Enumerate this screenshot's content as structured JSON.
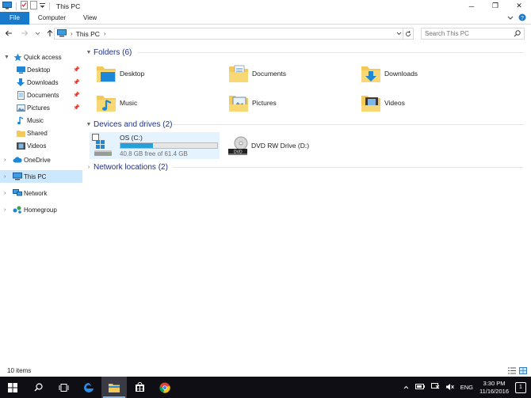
{
  "window": {
    "title": "This PC",
    "minimize": "─",
    "maximize": "❐",
    "close": "✕"
  },
  "ribbon": {
    "tabs": [
      "File",
      "Computer",
      "View"
    ]
  },
  "address": {
    "crumb": "This PC",
    "search_placeholder": "Search This PC"
  },
  "nav": {
    "quick_access": "Quick access",
    "quick_items": [
      "Desktop",
      "Downloads",
      "Documents",
      "Pictures",
      "Music",
      "Shared",
      "Videos"
    ],
    "onedrive": "OneDrive",
    "this_pc": "This PC",
    "network": "Network",
    "homegroup": "Homegroup"
  },
  "folders": {
    "header": "Folders (6)",
    "items": [
      "Desktop",
      "Documents",
      "Downloads",
      "Music",
      "Pictures",
      "Videos"
    ]
  },
  "devices": {
    "header": "Devices and drives (2)",
    "os_name": "OS (C:)",
    "os_free": "40.8 GB free of 61.4 GB",
    "os_used_fraction": 0.336,
    "dvd_name": "DVD RW Drive (D:)"
  },
  "network_locations": {
    "header": "Network locations (2)"
  },
  "status": {
    "items": "10 items"
  },
  "taskbar": {
    "lang": "ENG",
    "time": "3:30 PM",
    "date": "11/16/2016",
    "notifications": "1"
  },
  "colors": {
    "accent": "#1979ca",
    "selection": "#cce8ff",
    "group_header": "#1e3287",
    "drive_fill": "#26a0da",
    "taskbar": "#0e0e14"
  }
}
